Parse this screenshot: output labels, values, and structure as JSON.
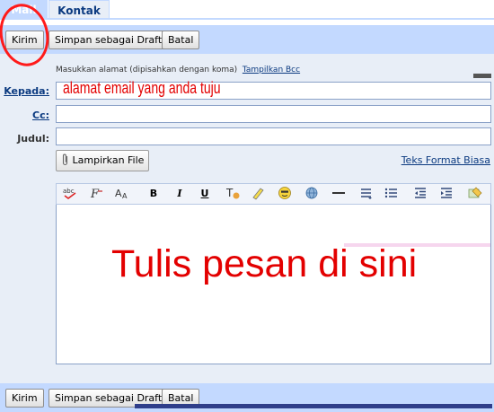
{
  "tabs": [
    {
      "label": "Mail"
    },
    {
      "label": "Kontak"
    }
  ],
  "toolbar_top": {
    "send": "Kirim",
    "save_draft": "Simpan sebagai Draft",
    "cancel": "Batal"
  },
  "compose": {
    "hint": "Masukkan alamat (dipisahkan dengan koma)",
    "show_bcc": "Tampilkan Bcc",
    "to_label": "Kepada:",
    "cc_label": "Cc:",
    "subject_label": "Judul:",
    "to_value": "",
    "cc_value": "",
    "subject_value": "",
    "attach_label": "Lampirkan File",
    "plain_text_link": "Teks Format Biasa",
    "body_value": ""
  },
  "editor_toolbar": {
    "icons": [
      "spellcheck-icon",
      "font-icon",
      "font-size-icon",
      "bold-icon",
      "italic-icon",
      "underline-icon",
      "text-color-icon",
      "highlight-icon",
      "emoticon-icon",
      "link-icon",
      "horizontal-rule-icon",
      "numbered-list-icon",
      "bulleted-list-icon",
      "outdent-icon",
      "indent-icon",
      "remove-format-icon"
    ],
    "bold_glyph": "B",
    "italic_glyph": "I",
    "underline_glyph": "U"
  },
  "toolbar_bottom": {
    "send": "Kirim",
    "save_draft": "Simpan sebagai Draft",
    "cancel": "Batal"
  },
  "annotations": {
    "email_hint": "alamat email yang anda tuju",
    "body_hint": "Tulis pesan di sini"
  },
  "colors": {
    "toolbar": "#c3d9ff",
    "compose_bg": "#e8eef7",
    "link": "#0b3a80",
    "annotation": "#e30000"
  }
}
